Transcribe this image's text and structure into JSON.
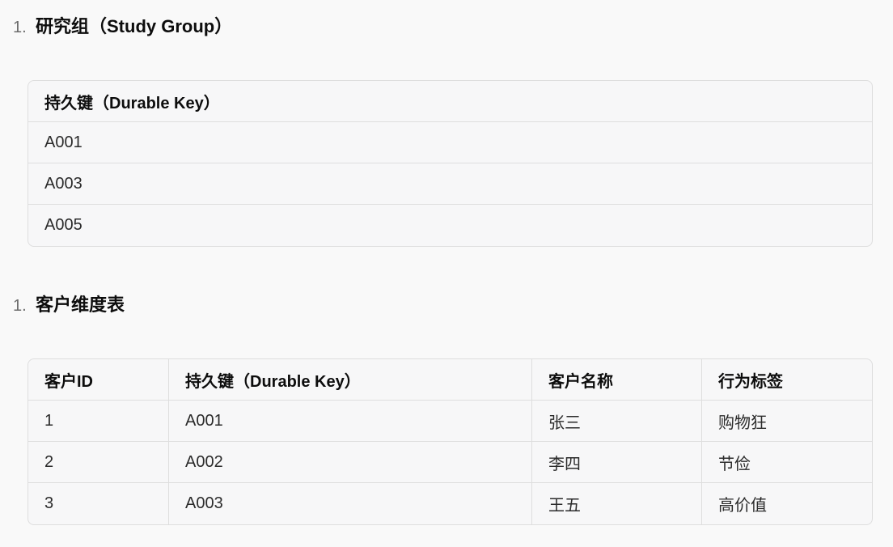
{
  "sections": [
    {
      "number": "1.",
      "title": "研究组（Study Group）",
      "table": {
        "headers": [
          "持久键（Durable Key）"
        ],
        "rows": [
          [
            "A001"
          ],
          [
            "A003"
          ],
          [
            "A005"
          ]
        ]
      }
    },
    {
      "number": "1.",
      "title": "客户维度表",
      "table": {
        "headers": [
          "客户ID",
          "持久键（Durable Key）",
          "客户名称",
          "行为标签"
        ],
        "rows": [
          [
            "1",
            "A001",
            "张三",
            "购物狂"
          ],
          [
            "2",
            "A002",
            "李四",
            "节俭"
          ],
          [
            "3",
            "A003",
            "王五",
            "高价值"
          ]
        ]
      }
    }
  ]
}
